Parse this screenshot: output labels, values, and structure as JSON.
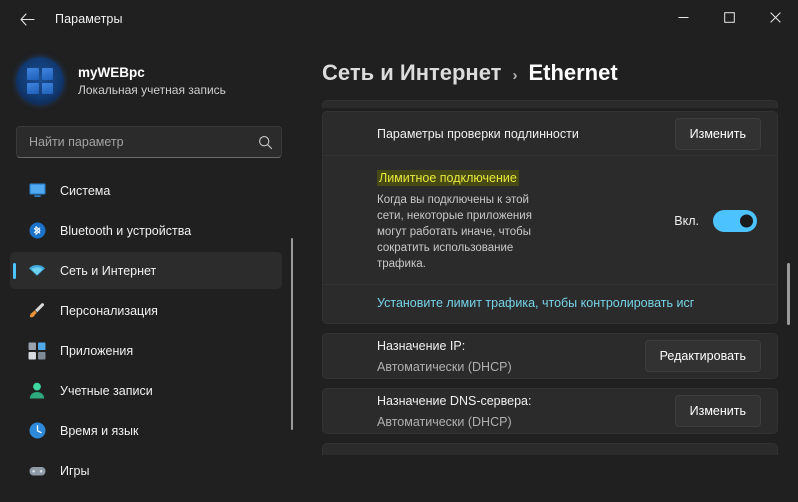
{
  "window": {
    "title": "Параметры",
    "back_icon": "back-arrow-icon",
    "minimize_label": "—",
    "maximize_label": "☐",
    "close_label": "✕"
  },
  "account": {
    "name": "myWEBpc",
    "subtitle": "Локальная учетная запись",
    "avatar_icon": "windows-logo-avatar"
  },
  "search": {
    "placeholder": "Найти параметр",
    "value": "",
    "icon": "search-icon"
  },
  "sidebar": {
    "items": [
      {
        "label": "Система",
        "icon": "system-monitor-icon",
        "selected": false
      },
      {
        "label": "Bluetooth и устройства",
        "icon": "bluetooth-icon",
        "selected": false
      },
      {
        "label": "Сеть и Интернет",
        "icon": "wifi-icon",
        "selected": true
      },
      {
        "label": "Персонализация",
        "icon": "paintbrush-icon",
        "selected": false
      },
      {
        "label": "Приложения",
        "icon": "apps-grid-icon",
        "selected": false
      },
      {
        "label": "Учетные записи",
        "icon": "person-icon",
        "selected": false
      },
      {
        "label": "Время и язык",
        "icon": "clock-icon",
        "selected": false
      },
      {
        "label": "Игры",
        "icon": "gamepad-icon",
        "selected": false
      }
    ]
  },
  "breadcrumb": {
    "parent": "Сеть и Интернет",
    "separator": "›",
    "current": "Ethernet"
  },
  "main": {
    "auth_row": {
      "label": "Параметры проверки подлинности",
      "button": "Изменить"
    },
    "metered": {
      "title": "Лимитное подключение",
      "description": "Когда вы подключены к этой сети, некоторые приложения могут работать иначе, чтобы сократить использование трафика.",
      "toggle_label": "Вкл.",
      "toggle_on": true,
      "link": "Установите лимит трафика, чтобы контролировать исг"
    },
    "ip_row": {
      "label": "Назначение IP:",
      "value": "Автоматически (DHCP)",
      "button": "Редактировать"
    },
    "dns_row": {
      "label": "Назначение DNS-сервера:",
      "value": "Автоматически (DHCP)",
      "button": "Изменить"
    }
  },
  "colors": {
    "accent": "#4cc2ff",
    "highlight_bg": "#474a15",
    "highlight_text": "#e8ea3a",
    "link": "#76d3e8",
    "card_bg": "#2b2b2b",
    "window_bg": "#202020"
  }
}
